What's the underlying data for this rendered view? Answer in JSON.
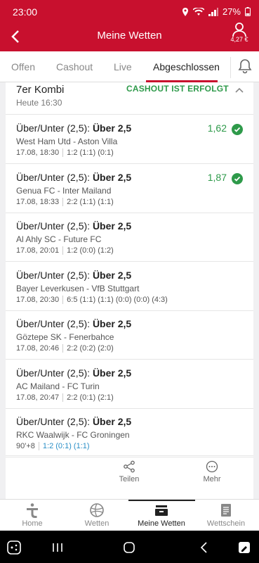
{
  "status_bar": {
    "time": "23:00",
    "battery": "27%"
  },
  "header": {
    "title": "Meine Wetten",
    "balance": "4,27 €"
  },
  "tabs": [
    {
      "label": "Offen"
    },
    {
      "label": "Cashout"
    },
    {
      "label": "Live"
    },
    {
      "label": "Abgeschlossen"
    }
  ],
  "bet": {
    "kind": "7er Kombi",
    "date": "Heute 16:30",
    "status": "CASHOUT IST ERFOLGT",
    "selections": [
      {
        "market": "Über/Unter (2,5): ",
        "pick": "Über 2,5",
        "match": "West Ham Utd - Aston Villa",
        "datetime": "17.08, 18:30",
        "score": "1:2 (1:1) (0:1)",
        "odds": "1,62",
        "won": true
      },
      {
        "market": "Über/Unter (2,5): ",
        "pick": "Über 2,5",
        "match": "Genua FC - Inter Mailand",
        "datetime": "17.08, 18:33",
        "score": "2:2 (1:1) (1:1)",
        "odds": "1,87",
        "won": true
      },
      {
        "market": "Über/Unter (2,5): ",
        "pick": "Über 2,5",
        "match": "Al Ahly SC - Future FC",
        "datetime": "17.08, 20:01",
        "score": "1:2 (0:0) (1:2)",
        "odds": "",
        "won": false
      },
      {
        "market": "Über/Unter (2,5): ",
        "pick": "Über 2,5",
        "match": "Bayer Leverkusen - VfB Stuttgart",
        "datetime": "17.08, 20:30",
        "score": "6:5 (1:1) (1:1) (0:0) (0:0) (4:3)",
        "odds": "",
        "won": false
      },
      {
        "market": "Über/Unter (2,5): ",
        "pick": "Über 2,5",
        "match": "Göztepe SK - Fenerbahce",
        "datetime": "17.08, 20:46",
        "score": "2:2 (0:2) (2:0)",
        "odds": "",
        "won": false
      },
      {
        "market": "Über/Unter (2,5): ",
        "pick": "Über 2,5",
        "match": "AC Mailand - FC Turin",
        "datetime": "17.08, 20:47",
        "score": "2:2 (0:1) (2:1)",
        "odds": "",
        "won": false
      },
      {
        "market": "Über/Unter (2,5): ",
        "pick": "Über 2,5",
        "match": "RKC Waalwijk - FC Groningen",
        "datetime": "90'+8",
        "score": "1:2 (0:1) (1:1)",
        "odds": "",
        "won": false,
        "live": true
      }
    ],
    "actions": {
      "share": "Teilen",
      "more": "Mehr"
    }
  },
  "bottom_nav": [
    {
      "label": "Home",
      "icon": "tipico-logo-icon"
    },
    {
      "label": "Wetten",
      "icon": "sports-ball-icon"
    },
    {
      "label": "Meine Wetten",
      "icon": "bets-tray-icon"
    },
    {
      "label": "Wettschein",
      "icon": "betslip-icon"
    }
  ],
  "colors": {
    "brand": "#c8102e",
    "win": "#2e9a4a",
    "live": "#2a8fc7"
  }
}
